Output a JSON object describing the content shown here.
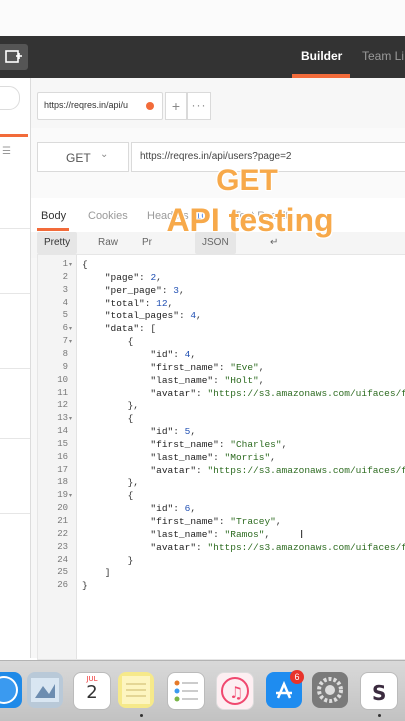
{
  "header": {
    "tabs": [
      "Builder",
      "Team Li"
    ]
  },
  "request_tab": {
    "label": "https://reqres.in/api/u"
  },
  "request": {
    "method": "GET",
    "url": "https://reqres.in/api/users?page=2"
  },
  "response_tabs": {
    "body": "Body",
    "cookies": "Cookies",
    "headers": "Headers",
    "headers_count": "(10)",
    "tests": "Test Results"
  },
  "format_bar": {
    "pretty": "Pretty",
    "raw": "Raw",
    "preview": "Pr",
    "json": "JSON",
    "wrap": "↵"
  },
  "overlay": {
    "line1": "GET",
    "line2": "API testing"
  },
  "code_lines": [
    "{",
    "    \"page\": 2,",
    "    \"per_page\": 3,",
    "    \"total\": 12,",
    "    \"total_pages\": 4,",
    "    \"data\": [",
    "        {",
    "            \"id\": 4,",
    "            \"first_name\": \"Eve\",",
    "            \"last_name\": \"Holt\",",
    "            \"avatar\": \"https://s3.amazonaws.com/uifaces/f",
    "        },",
    "        {",
    "            \"id\": 5,",
    "            \"first_name\": \"Charles\",",
    "            \"last_name\": \"Morris\",",
    "            \"avatar\": \"https://s3.amazonaws.com/uifaces/f",
    "        },",
    "        {",
    "            \"id\": 6,",
    "            \"first_name\": \"Tracey\",",
    "            \"last_name\": \"Ramos\",",
    "            \"avatar\": \"https://s3.amazonaws.com/uifaces/f",
    "        }",
    "    ]",
    "}"
  ],
  "fold_lines": [
    1,
    6,
    7,
    13,
    19
  ],
  "dock": {
    "calendar_day": "2",
    "calendar_month": "JUL",
    "app_store_badge": "6"
  },
  "colors": {
    "accent": "#f26b3a",
    "header_bg": "#333333",
    "overlay_text": "#f7a94a"
  }
}
